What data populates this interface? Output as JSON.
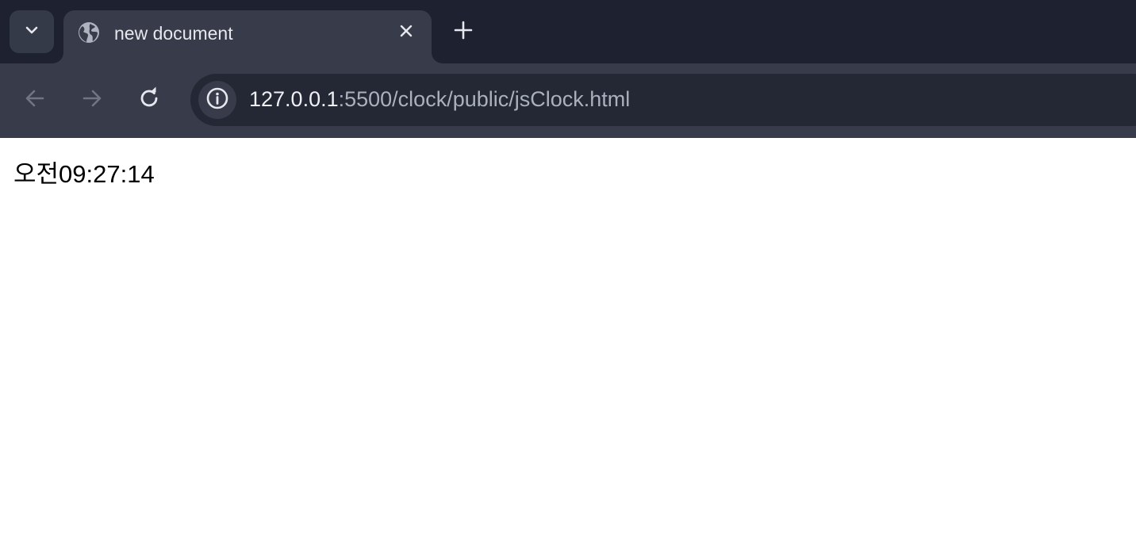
{
  "tabs": [
    {
      "title": "new document",
      "favicon": "globe-icon",
      "active": true
    }
  ],
  "tabstrip": {
    "tab_search_icon": "chevron-down-icon",
    "close_icon": "close-icon",
    "new_tab_icon": "plus-icon"
  },
  "toolbar": {
    "back_icon": "arrow-left-icon",
    "forward_icon": "arrow-right-icon",
    "reload_icon": "reload-icon",
    "site_info_icon": "info-icon",
    "url_host": "127.0.0.1",
    "url_path": ":5500/clock/public/jsClock.html"
  },
  "page": {
    "clock_text": "오전09:27:14"
  },
  "colors": {
    "tabstrip_bg": "#1e2230",
    "active_tab_bg": "#373b4a",
    "omnibox_bg": "#242835",
    "page_bg": "#ffffff"
  }
}
